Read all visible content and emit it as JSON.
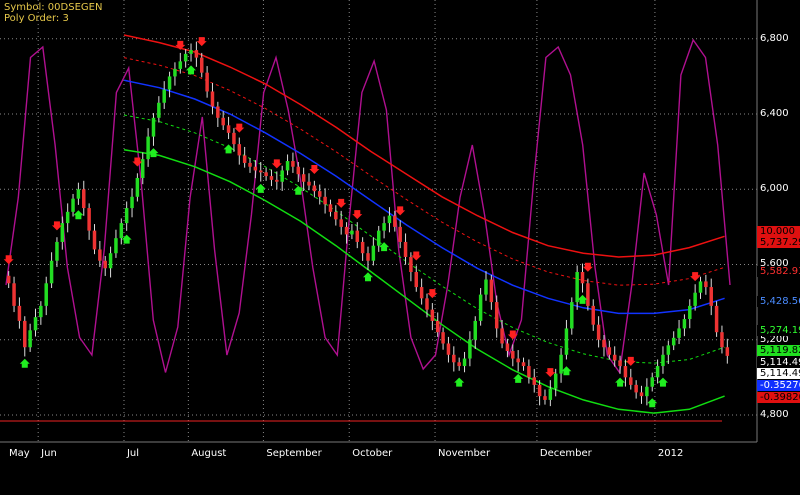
{
  "header": {
    "symbol_line": "Symbol: 00DSEGEN",
    "poly_line": "Poly Order: 3"
  },
  "y_axis_labels": [
    "6,800",
    "6,400",
    "6,000",
    "5,600",
    "5,200",
    "4,800"
  ],
  "x_axis_labels": [
    "May",
    "Jun",
    "Jul",
    "August",
    "September",
    "October",
    "November",
    "December",
    "2012"
  ],
  "badges": [
    {
      "text": "10.000",
      "bg": "#e01010",
      "fg": "#000000"
    },
    {
      "text": "5,737.29",
      "bg": "#e01010",
      "fg": "#000000"
    },
    {
      "text": "5,582.93",
      "bg": "#000000",
      "fg": "#ff3030"
    },
    {
      "text": "5,428.56",
      "bg": "#000000",
      "fg": "#4a8cff"
    },
    {
      "text": "5,274.19",
      "bg": "#000000",
      "fg": "#30ff30"
    },
    {
      "text": "5,119.82",
      "bg": "#20e020",
      "fg": "#000000"
    },
    {
      "text": "5,114.49",
      "bg": "#000000",
      "fg": "#ffffff"
    },
    {
      "text": "5,114.49",
      "bg": "#ffffff",
      "fg": "#000000"
    },
    {
      "text": "-0.352765",
      "bg": "#1030ff",
      "fg": "#ffffff"
    },
    {
      "text": "-0.398200",
      "bg": "#e01010",
      "fg": "#000000"
    }
  ],
  "colors": {
    "background": "#000000",
    "up_candle": "#22dd22",
    "down_candle": "#ee3333",
    "upper_band": "#ee1111",
    "middle_line": "#1133ff",
    "lower_band": "#11dd11",
    "oscillator": "#b01090",
    "grid": "#888888"
  },
  "chart_data": {
    "type": "candlestick",
    "symbol": "00DSEGEN",
    "poly_order": 3,
    "ylim": [
      4720,
      6900
    ],
    "y_ticks": [
      6800,
      6400,
      6000,
      5600,
      5200,
      4800
    ],
    "month_separators": [
      "Jun",
      "Jul",
      "August",
      "September",
      "October",
      "November",
      "December",
      "2012"
    ],
    "close_series": [
      5500,
      5380,
      5300,
      5160,
      5250,
      5320,
      5380,
      5500,
      5620,
      5720,
      5820,
      5880,
      5950,
      6000,
      5900,
      5780,
      5680,
      5620,
      5580,
      5660,
      5740,
      5820,
      5900,
      5960,
      6060,
      6160,
      6280,
      6380,
      6460,
      6530,
      6600,
      6640,
      6680,
      6720,
      6740,
      6700,
      6620,
      6520,
      6440,
      6380,
      6340,
      6300,
      6240,
      6180,
      6140,
      6120,
      6100,
      6090,
      6070,
      6050,
      6040,
      6100,
      6150,
      6120,
      6080,
      6040,
      6020,
      5990,
      5960,
      5920,
      5880,
      5840,
      5800,
      5760,
      5780,
      5720,
      5660,
      5620,
      5700,
      5780,
      5820,
      5860,
      5800,
      5720,
      5640,
      5560,
      5480,
      5420,
      5360,
      5300,
      5240,
      5180,
      5120,
      5080,
      5060,
      5100,
      5200,
      5300,
      5440,
      5520,
      5400,
      5260,
      5180,
      5140,
      5100,
      5080,
      5060,
      5000,
      4960,
      4900,
      4880,
      4940,
      5020,
      5120,
      5260,
      5400,
      5560,
      5500,
      5380,
      5280,
      5200,
      5160,
      5120,
      5090,
      5060,
      5000,
      4960,
      4920,
      4900,
      4950,
      5000,
      5060,
      5120,
      5170,
      5210,
      5260,
      5310,
      5380,
      5450,
      5510,
      5480,
      5380,
      5240,
      5160,
      5114
    ],
    "upper_band": [
      6820,
      6780,
      6730,
      6650,
      6560,
      6450,
      6330,
      6200,
      6080,
      5960,
      5860,
      5770,
      5700,
      5660,
      5640,
      5650,
      5690,
      5750
    ],
    "middle_line": [
      6580,
      6540,
      6480,
      6400,
      6300,
      6190,
      6070,
      5940,
      5810,
      5690,
      5580,
      5490,
      5420,
      5370,
      5340,
      5340,
      5360,
      5420
    ],
    "lower_band": [
      6210,
      6180,
      6120,
      6040,
      5940,
      5830,
      5700,
      5560,
      5420,
      5280,
      5150,
      5040,
      4950,
      4880,
      4830,
      4810,
      4830,
      4900
    ],
    "oscillator_levels": [
      0.3,
      0.55,
      0.95,
      0.98,
      0.7,
      0.35,
      0.15,
      0.1,
      0.4,
      0.85,
      0.92,
      0.6,
      0.2,
      0.05,
      0.18,
      0.55,
      0.78,
      0.4,
      0.1,
      0.22,
      0.5,
      0.85,
      0.95,
      0.8,
      0.6,
      0.35,
      0.15,
      0.1,
      0.5,
      0.85,
      0.94,
      0.8,
      0.4,
      0.15,
      0.06,
      0.1,
      0.3,
      0.55,
      0.7,
      0.5,
      0.25,
      0.1,
      0.2,
      0.6,
      0.95,
      0.98,
      0.9,
      0.7,
      0.35,
      0.1,
      0.05,
      0.3,
      0.62,
      0.5,
      0.3,
      0.9,
      1.0,
      0.95,
      0.7,
      0.3
    ],
    "down_signal_bars": [
      0,
      9,
      24,
      32,
      36,
      43,
      50,
      57,
      62,
      65,
      73,
      76,
      79,
      94,
      101,
      108,
      116,
      128
    ],
    "up_signal_bars": [
      3,
      13,
      22,
      27,
      34,
      41,
      47,
      54,
      67,
      70,
      84,
      95,
      104,
      107,
      114,
      120,
      122
    ]
  }
}
